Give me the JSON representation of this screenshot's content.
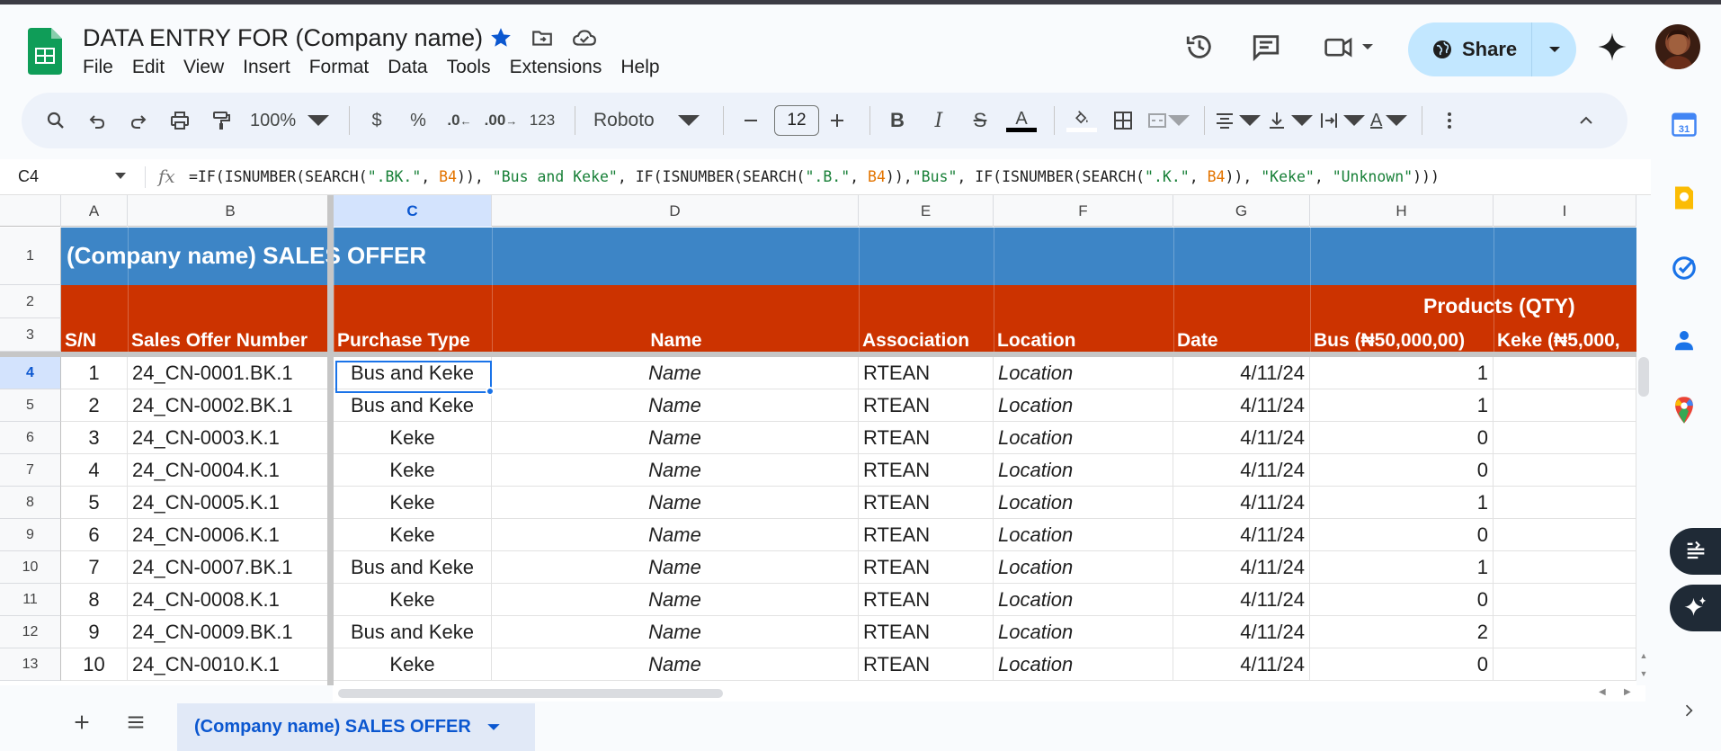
{
  "document": {
    "title": "DATA ENTRY FOR (Company name)"
  },
  "menu": [
    "File",
    "Edit",
    "View",
    "Insert",
    "Format",
    "Data",
    "Tools",
    "Extensions",
    "Help"
  ],
  "share": {
    "label": "Share"
  },
  "toolbar": {
    "zoom": "100%",
    "currency": "$",
    "percent": "%",
    "dec_decrease": ".0",
    "dec_increase": ".00",
    "number_format": "123",
    "font": "Roboto",
    "font_size": "12"
  },
  "formula_bar": {
    "name_box": "C4",
    "fx": "fx",
    "formula_parts": [
      {
        "t": "=IF(ISNUMBER(SEARCH(",
        "k": "op"
      },
      {
        "t": "\".BK.\"",
        "k": "str"
      },
      {
        "t": ", ",
        "k": "op"
      },
      {
        "t": "B4",
        "k": "ref"
      },
      {
        "t": ")), ",
        "k": "op"
      },
      {
        "t": "\"Bus and Keke\"",
        "k": "str"
      },
      {
        "t": ", IF(ISNUMBER(SEARCH(",
        "k": "op"
      },
      {
        "t": "\".B.\"",
        "k": "str"
      },
      {
        "t": ", ",
        "k": "op"
      },
      {
        "t": "B4",
        "k": "ref"
      },
      {
        "t": ")),",
        "k": "op"
      },
      {
        "t": "\"Bus\"",
        "k": "str"
      },
      {
        "t": ", IF(ISNUMBER(SEARCH(",
        "k": "op"
      },
      {
        "t": "\".K.\"",
        "k": "str"
      },
      {
        "t": ", ",
        "k": "op"
      },
      {
        "t": "B4",
        "k": "ref"
      },
      {
        "t": ")), ",
        "k": "op"
      },
      {
        "t": "\"Keke\"",
        "k": "str"
      },
      {
        "t": ", ",
        "k": "op"
      },
      {
        "t": "\"Unknown\"",
        "k": "str"
      },
      {
        "t": ")))",
        "k": "op"
      }
    ]
  },
  "sheet": {
    "columns": [
      "A",
      "B",
      "C",
      "D",
      "E",
      "F",
      "G",
      "H",
      "I"
    ],
    "selected_column": "C",
    "selected_row": "4",
    "row_numbers": [
      "1",
      "2",
      "3",
      "4",
      "5",
      "6",
      "7",
      "8",
      "9",
      "10",
      "11",
      "12",
      "13"
    ],
    "title_cell": "(Company name) SALES OFFER",
    "products_header": "Products (QTY)",
    "headers": [
      "S/N",
      "Sales Offer Number",
      "Purchase Type",
      "Name",
      "Association",
      "Location",
      "Date",
      "Bus (₦50,000,00)",
      "Keke (₦5,000,"
    ],
    "rows": [
      [
        "1",
        "24_CN-0001.BK.1",
        "Bus and Keke",
        "Name",
        "RTEAN",
        "Location",
        "4/11/24",
        "1",
        ""
      ],
      [
        "2",
        "24_CN-0002.BK.1",
        "Bus and Keke",
        "Name",
        "RTEAN",
        "Location",
        "4/11/24",
        "1",
        ""
      ],
      [
        "3",
        "24_CN-0003.K.1",
        "Keke",
        "Name",
        "RTEAN",
        "Location",
        "4/11/24",
        "0",
        ""
      ],
      [
        "4",
        "24_CN-0004.K.1",
        "Keke",
        "Name",
        "RTEAN",
        "Location",
        "4/11/24",
        "0",
        ""
      ],
      [
        "5",
        " 24_CN-0005.K.1",
        "Keke",
        "Name",
        "RTEAN",
        "Location",
        "4/11/24",
        "1",
        ""
      ],
      [
        "6",
        "24_CN-0006.K.1",
        "Keke",
        "Name",
        "RTEAN",
        "Location",
        "4/11/24",
        "0",
        ""
      ],
      [
        "7",
        "24_CN-0007.BK.1",
        "Bus and Keke",
        "Name",
        "RTEAN",
        "Location",
        "4/11/24",
        "1",
        ""
      ],
      [
        "8",
        "24_CN-0008.K.1",
        "Keke",
        "Name",
        "RTEAN",
        "Location",
        "4/11/24",
        "0",
        ""
      ],
      [
        "9",
        "24_CN-0009.BK.1",
        "Bus and Keke",
        "Name",
        "RTEAN",
        "Location",
        "4/11/24",
        "2",
        ""
      ],
      [
        "10",
        "24_CN-0010.K.1",
        "Keke",
        "Name",
        "RTEAN",
        "Location",
        "4/11/24",
        "0",
        ""
      ]
    ]
  },
  "sheet_tabs": [
    {
      "label": "(Company name) SALES OFFER",
      "active": true
    }
  ],
  "colors": {
    "title_band": "#3d85c6",
    "header_band": "#cc3300",
    "selection": "#1a73e8",
    "share_button": "#c2e7ff",
    "sheets_green": "#0f9d58"
  }
}
